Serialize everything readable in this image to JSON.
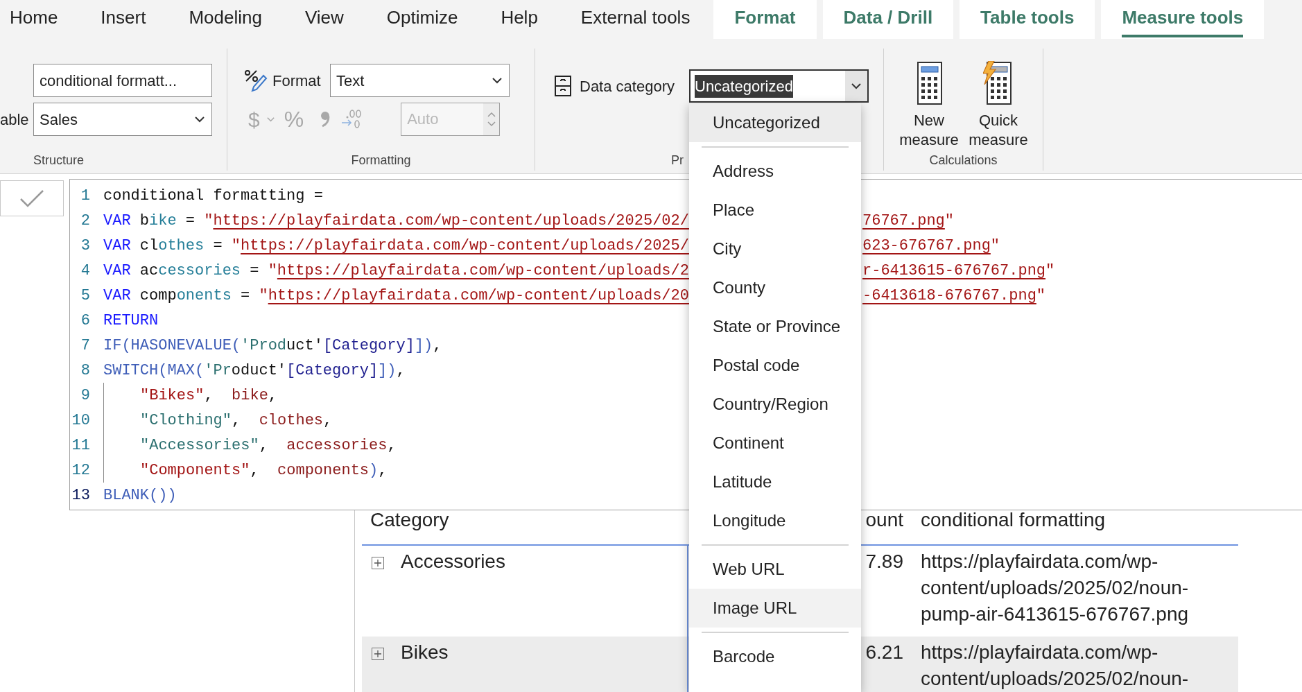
{
  "ribbon_tabs": [
    {
      "label": "Home",
      "kind": "standard",
      "selected": false
    },
    {
      "label": "Insert",
      "kind": "standard",
      "selected": false
    },
    {
      "label": "Modeling",
      "kind": "standard",
      "selected": false
    },
    {
      "label": "View",
      "kind": "standard",
      "selected": false
    },
    {
      "label": "Optimize",
      "kind": "standard",
      "selected": false
    },
    {
      "label": "Help",
      "kind": "standard",
      "selected": false
    },
    {
      "label": "External tools",
      "kind": "standard",
      "selected": false
    },
    {
      "label": "Format",
      "kind": "contextual",
      "selected": false
    },
    {
      "label": "Data / Drill",
      "kind": "contextual",
      "selected": false
    },
    {
      "label": "Table tools",
      "kind": "contextual",
      "selected": false
    },
    {
      "label": "Measure tools",
      "kind": "contextual",
      "selected": true
    }
  ],
  "structure": {
    "name_field": {
      "value": "conditional formatt..."
    },
    "table_label": "able",
    "table_dropdown": {
      "value": "Sales"
    },
    "group_label": "Structure"
  },
  "formatting": {
    "format_label": "Format",
    "format_dropdown": {
      "value": "Text"
    },
    "buttons": [
      {
        "kind": "currency",
        "glyph": "$",
        "disabled": true
      },
      {
        "kind": "percent",
        "glyph": "%",
        "disabled": true
      },
      {
        "kind": "comma",
        "disabled": true
      },
      {
        "kind": "decimal",
        "disabled": true
      }
    ],
    "decimal_places": {
      "placeholder": "Auto",
      "disabled": true
    },
    "group_label": "Formatting"
  },
  "properties": {
    "data_category_label": "Data category",
    "data_category_dropdown": {
      "value": "Uncategorized",
      "expanded": true
    },
    "group_label": "Pr"
  },
  "calculations": {
    "buttons": [
      {
        "kind": "new",
        "label": "New measure"
      },
      {
        "kind": "quick",
        "label": "Quick measure"
      }
    ],
    "group_label": "Calculations"
  },
  "code_editor": {
    "lines": [
      {
        "number": "1",
        "current": false,
        "indented": false,
        "tokens": [
          {
            "kind": "plain",
            "text": "conditional formatting ="
          }
        ]
      },
      {
        "number": "2",
        "current": false,
        "indented": false,
        "tokens": [
          {
            "kind": "keyword",
            "text": "VAR"
          },
          {
            "kind": "plain",
            "text": " b"
          },
          {
            "kind": "var",
            "text": "ike"
          },
          {
            "kind": "plain",
            "text": " = "
          },
          {
            "kind": "string",
            "text": "\""
          },
          {
            "kind": "url",
            "text": "https://playfairdata.com/wp-content/uploads/2025/02/"
          }
        ],
        "tail": [
          {
            "kind": "url",
            "text": "76767.png"
          },
          {
            "kind": "string",
            "text": "\""
          }
        ]
      },
      {
        "number": "3",
        "current": false,
        "indented": false,
        "tokens": [
          {
            "kind": "keyword",
            "text": "VAR"
          },
          {
            "kind": "plain",
            "text": " cl"
          },
          {
            "kind": "var",
            "text": "othes"
          },
          {
            "kind": "plain",
            "text": " = "
          },
          {
            "kind": "string",
            "text": "\""
          },
          {
            "kind": "url",
            "text": "https://playfairdata.com/wp-content/uploads/2025/"
          }
        ],
        "tail": [
          {
            "kind": "url",
            "text": "623-676767.png"
          },
          {
            "kind": "string",
            "text": "\""
          }
        ]
      },
      {
        "number": "4",
        "current": false,
        "indented": false,
        "tokens": [
          {
            "kind": "keyword",
            "text": "VAR"
          },
          {
            "kind": "plain",
            "text": " ac"
          },
          {
            "kind": "var",
            "text": "cessories"
          },
          {
            "kind": "plain",
            "text": " = "
          },
          {
            "kind": "string",
            "text": "\""
          },
          {
            "kind": "url",
            "text": "https://playfairdata.com/wp-content/uploads/2"
          }
        ],
        "tail": [
          {
            "kind": "url",
            "text": "r-6413615-676767.png"
          },
          {
            "kind": "string",
            "text": "\""
          }
        ]
      },
      {
        "number": "5",
        "current": false,
        "indented": false,
        "tokens": [
          {
            "kind": "keyword",
            "text": "VAR"
          },
          {
            "kind": "plain",
            "text": " comp"
          },
          {
            "kind": "var",
            "text": "onents"
          },
          {
            "kind": "plain",
            "text": " = "
          },
          {
            "kind": "string",
            "text": "\""
          },
          {
            "kind": "url",
            "text": "https://playfairdata.com/wp-content/uploads/20"
          }
        ],
        "tail": [
          {
            "kind": "url",
            "text": "-6413618-676767.png"
          },
          {
            "kind": "string",
            "text": "\""
          }
        ]
      },
      {
        "number": "6",
        "current": false,
        "indented": false,
        "tokens": [
          {
            "kind": "keyword",
            "text": "RETURN"
          }
        ]
      },
      {
        "number": "7",
        "current": false,
        "indented": false,
        "tokens": [
          {
            "kind": "fn",
            "text": "IF(HASONEVALUE("
          },
          {
            "kind": "table",
            "text": "'Prod"
          },
          {
            "kind": "plain",
            "text": "uct'"
          },
          {
            "kind": "column",
            "text": "[Category]"
          },
          {
            "kind": "fn",
            "text": "])"
          },
          {
            "kind": "plain",
            "text": ","
          }
        ]
      },
      {
        "number": "8",
        "current": false,
        "indented": false,
        "tokens": [
          {
            "kind": "fn",
            "text": "SWITCH(MAX("
          },
          {
            "kind": "table",
            "text": "'Pr"
          },
          {
            "kind": "plain",
            "text": "oduct'"
          },
          {
            "kind": "column",
            "text": "[Category]"
          },
          {
            "kind": "fn",
            "text": "])"
          },
          {
            "kind": "plain",
            "text": ","
          }
        ]
      },
      {
        "number": "9",
        "current": false,
        "indented": true,
        "tokens": [
          {
            "kind": "string",
            "text": "\"Bikes\""
          },
          {
            "kind": "plain",
            "text": ",  "
          },
          {
            "kind": "ref",
            "text": "bike"
          },
          {
            "kind": "plain",
            "text": ","
          }
        ]
      },
      {
        "number": "10",
        "current": false,
        "indented": true,
        "tokens": [
          {
            "kind": "table",
            "text": "\"Clothing\""
          },
          {
            "kind": "plain",
            "text": ",  "
          },
          {
            "kind": "ref",
            "text": "clothes"
          },
          {
            "kind": "plain",
            "text": ","
          }
        ]
      },
      {
        "number": "11",
        "current": false,
        "indented": true,
        "tokens": [
          {
            "kind": "table",
            "text": "\"Accessories\""
          },
          {
            "kind": "plain",
            "text": ",  "
          },
          {
            "kind": "ref",
            "text": "accessories"
          },
          {
            "kind": "plain",
            "text": ","
          }
        ]
      },
      {
        "number": "12",
        "current": false,
        "indented": true,
        "tokens": [
          {
            "kind": "string",
            "text": "\"Components\""
          },
          {
            "kind": "plain",
            "text": ",  "
          },
          {
            "kind": "ref",
            "text": "components"
          },
          {
            "kind": "fn",
            "text": ")"
          },
          {
            "kind": "plain",
            "text": ","
          }
        ]
      },
      {
        "number": "13",
        "current": true,
        "indented": false,
        "tokens": [
          {
            "kind": "fn",
            "text": "BLANK())"
          }
        ]
      }
    ]
  },
  "data_category_options": [
    {
      "kind": "option",
      "label": "Uncategorized",
      "selected": true,
      "hovered": false
    },
    {
      "kind": "separator"
    },
    {
      "kind": "option",
      "label": "Address",
      "selected": false,
      "hovered": false
    },
    {
      "kind": "option",
      "label": "Place",
      "selected": false,
      "hovered": false
    },
    {
      "kind": "option",
      "label": "City",
      "selected": false,
      "hovered": false
    },
    {
      "kind": "option",
      "label": "County",
      "selected": false,
      "hovered": false
    },
    {
      "kind": "option",
      "label": "State or Province",
      "selected": false,
      "hovered": false
    },
    {
      "kind": "option",
      "label": "Postal code",
      "selected": false,
      "hovered": false
    },
    {
      "kind": "option",
      "label": "Country/Region",
      "selected": false,
      "hovered": false
    },
    {
      "kind": "option",
      "label": "Continent",
      "selected": false,
      "hovered": false
    },
    {
      "kind": "option",
      "label": "Latitude",
      "selected": false,
      "hovered": false
    },
    {
      "kind": "option",
      "label": "Longitude",
      "selected": false,
      "hovered": false
    },
    {
      "kind": "separator"
    },
    {
      "kind": "option",
      "label": "Web URL",
      "selected": false,
      "hovered": false
    },
    {
      "kind": "option",
      "label": "Image URL",
      "selected": false,
      "hovered": true
    },
    {
      "kind": "separator"
    },
    {
      "kind": "option",
      "label": "Barcode",
      "selected": false,
      "hovered": false
    }
  ],
  "table": {
    "columns": [
      "Category",
      "ount",
      "conditional formatting"
    ],
    "rows": [
      {
        "cells": [
          "Accessories",
          "7.89",
          "https://playfairdata.com/wp-content/uploads/2025/02/noun-pump-air-6413615-676767.png"
        ]
      },
      {
        "cells": [
          "Bikes",
          "6.21",
          "https://playfairdata.com/wp-content/uploads/2025/02/noun-"
        ]
      }
    ]
  }
}
